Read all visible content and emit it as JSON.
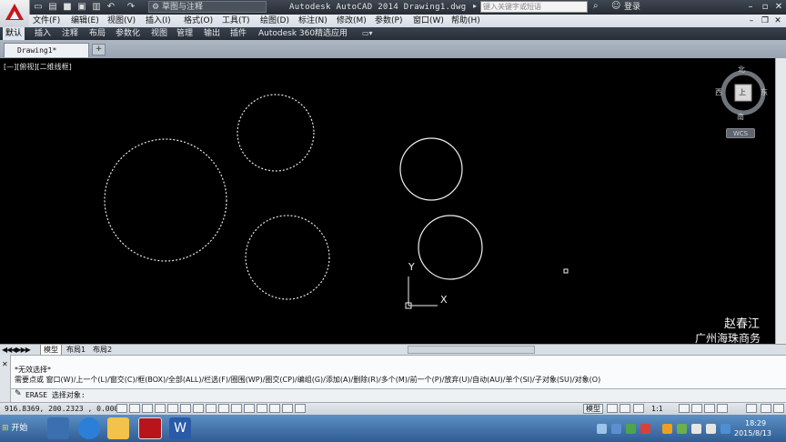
{
  "titlebar": {
    "workspace": "草图与注释",
    "title": "Autodesk AutoCAD 2014    Drawing1.dwg",
    "search_placeholder": "键入关键字或短语",
    "login": "登录",
    "qa_icons": [
      "new-icon",
      "open-icon",
      "save-icon",
      "saveas-icon",
      "print-icon",
      "undo-icon",
      "redo-icon"
    ]
  },
  "menu": [
    "文件(F)",
    "编辑(E)",
    "视图(V)",
    "插入(I)",
    "格式(O)",
    "工具(T)",
    "绘图(D)",
    "标注(N)",
    "修改(M)",
    "参数(P)",
    "窗口(W)",
    "帮助(H)"
  ],
  "ribbon_tabs": [
    "默认",
    "插入",
    "注释",
    "布局",
    "参数化",
    "视图",
    "管理",
    "输出",
    "插件",
    "Autodesk 360",
    "精选应用"
  ],
  "document_tab": "Drawing1*",
  "viewport_label": "[—][俯视][二维线框]",
  "viewcube": {
    "north": "北",
    "south": "南",
    "east": "东",
    "west": "西",
    "face": "上",
    "wcs": "WCS"
  },
  "ucs": {
    "x": "X",
    "y": "Y"
  },
  "watermark": {
    "line1": "赵春江",
    "line2": "广州海珠商务"
  },
  "layout_tabs": [
    "模型",
    "布局1",
    "布局2"
  ],
  "command": {
    "line1": "*无效选择*",
    "line2": "需要点或 窗口(W)/上一个(L)/窗交(C)/框(BOX)/全部(ALL)/栏选(F)/圈围(WP)/圈交(CP)/编组(G)/添加(A)/删除(R)/多个(M)/前一个(P)/放弃(U)/自动(AU)/单个(SI)/子对象(SU)/对象(O)",
    "prompt": "ERASE 选择对象:"
  },
  "status": {
    "coords": "916.8369, 200.2323 , 0.0000",
    "model": "模型",
    "scale": "1:1"
  },
  "taskbar": {
    "start": "开始",
    "time": "18:29",
    "date": "2015/8/13"
  },
  "colors": {
    "canvas": "#000000",
    "accent_red": "#c8141b",
    "taskbar": "#2f5d93"
  }
}
